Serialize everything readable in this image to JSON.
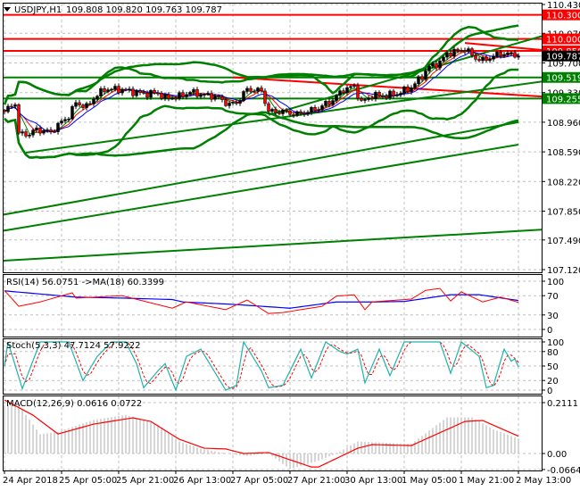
{
  "header": {
    "symbol": "USDJPY,H1",
    "ohlc": "109.808 109.820 109.763 109.787"
  },
  "indicators": {
    "rsi_label": "RSI(14) 56.0751  ->MA(18) 60.3399",
    "stoch_label": "Stoch(5,3,3) 47.7124 57.9222",
    "macd_label": "MACD(12,26,9) 0.0616 0.0722"
  },
  "colors": {
    "up": "#000000",
    "down": "#ff0000",
    "support": "#008000",
    "resistance": "#ff0000",
    "rsi": "#ff0000",
    "rsi_ma": "#0000ff",
    "stoch_main": "#20b2aa",
    "stoch_signal": "#ff0000",
    "macd_hist": "#c0c0c0",
    "macd_signal": "#ff0000",
    "current": "#000000"
  },
  "chart_data": [
    {
      "type": "candlestick",
      "title": "USDJPY,H1",
      "ylim": [
        107.12,
        110.43
      ],
      "y_ticks": [
        "110.430",
        "110.070",
        "109.700",
        "109.330",
        "108.960",
        "108.590",
        "108.220",
        "107.850",
        "107.490",
        "107.120"
      ],
      "x_ticks": [
        "24 Apr 2018",
        "25 Apr 05:00",
        "25 Apr 21:00",
        "26 Apr 13:00",
        "27 Apr 05:00",
        "27 Apr 21:00",
        "30 Apr 13:00",
        "1 May 05:00",
        "1 May 21:00",
        "2 May 13:00"
      ],
      "bars": 145,
      "close_keypoints": [
        [
          0,
          109.092
        ],
        [
          3,
          109.204
        ],
        [
          4,
          108.813
        ],
        [
          7,
          108.813
        ],
        [
          9,
          108.869
        ],
        [
          13,
          108.836
        ],
        [
          15,
          108.925
        ],
        [
          18,
          109.036
        ],
        [
          20,
          109.204
        ],
        [
          23,
          109.148
        ],
        [
          25,
          109.259
        ],
        [
          28,
          109.371
        ],
        [
          32,
          109.371
        ],
        [
          35,
          109.349
        ],
        [
          39,
          109.315
        ],
        [
          43,
          109.326
        ],
        [
          45,
          109.259
        ],
        [
          49,
          109.282
        ],
        [
          52,
          109.337
        ],
        [
          55,
          109.304
        ],
        [
          59,
          109.282
        ],
        [
          63,
          109.181
        ],
        [
          65,
          109.204
        ],
        [
          68,
          109.371
        ],
        [
          72,
          109.349
        ],
        [
          74,
          109.092
        ],
        [
          78,
          109.092
        ],
        [
          82,
          109.059
        ],
        [
          85,
          109.092
        ],
        [
          88,
          109.137
        ],
        [
          92,
          109.237
        ],
        [
          95,
          109.371
        ],
        [
          98,
          109.404
        ],
        [
          100,
          109.204
        ],
        [
          103,
          109.293
        ],
        [
          107,
          109.293
        ],
        [
          110,
          109.315
        ],
        [
          114,
          109.393
        ],
        [
          117,
          109.538
        ],
        [
          119,
          109.65
        ],
        [
          122,
          109.705
        ],
        [
          124,
          109.817
        ],
        [
          127,
          109.85
        ],
        [
          129,
          109.873
        ],
        [
          132,
          109.761
        ],
        [
          134,
          109.728
        ],
        [
          137,
          109.783
        ],
        [
          139,
          109.817
        ],
        [
          143,
          109.806
        ],
        [
          144,
          109.787
        ]
      ],
      "levels": [
        {
          "price": 110.3,
          "label": "110.300",
          "color": "#ff0000"
        },
        {
          "price": 110.0,
          "label": "110.000",
          "color": "#ff0000"
        },
        {
          "price": 109.85,
          "label": "109.850",
          "color": "#ff0000"
        },
        {
          "price": 109.787,
          "label": "109.787",
          "color": "#000000"
        },
        {
          "price": 109.519,
          "label": "109.519",
          "color": "#008000"
        },
        {
          "price": 109.255,
          "label": "109.255",
          "color": "#008000"
        }
      ],
      "trendlines": [
        {
          "from": [
            64,
            109.52
          ],
          "to": [
            151,
            109.28
          ],
          "color": "#ff0000"
        },
        {
          "from": [
            129,
            109.95
          ],
          "to": [
            151,
            109.86
          ],
          "color": "#ff0000"
        },
        {
          "from": [
            6,
            108.58
          ],
          "to": [
            151,
            109.47
          ],
          "color": "#008000"
        },
        {
          "from": [
            -1,
            107.8
          ],
          "to": [
            144,
            108.96
          ],
          "color": "#008000"
        },
        {
          "from": [
            -1,
            107.6
          ],
          "to": [
            144,
            108.68
          ],
          "color": "#008000"
        },
        {
          "from": [
            -1,
            107.23
          ],
          "to": [
            151,
            107.62
          ],
          "color": "#008000"
        },
        {
          "from": [
            74,
            109.05
          ],
          "to": [
            151,
            110.04
          ],
          "color": "#008000"
        }
      ]
    },
    {
      "type": "line",
      "title": "RSI(14)",
      "ylim": [
        0,
        100
      ],
      "y_ticks": [
        "100",
        "70",
        "30",
        "0"
      ],
      "series": [
        {
          "name": "RSI",
          "keypoints": [
            [
              0,
              81
            ],
            [
              4,
              48
            ],
            [
              10,
              57
            ],
            [
              19,
              76
            ],
            [
              20,
              65
            ],
            [
              33,
              70
            ],
            [
              47,
              44
            ],
            [
              51,
              57
            ],
            [
              62,
              41
            ],
            [
              68,
              61
            ],
            [
              74,
              33
            ],
            [
              78,
              35
            ],
            [
              89,
              48
            ],
            [
              93,
              69
            ],
            [
              98,
              72
            ],
            [
              101,
              41
            ],
            [
              103,
              57
            ],
            [
              114,
              63
            ],
            [
              118,
              81
            ],
            [
              122,
              85
            ],
            [
              125,
              59
            ],
            [
              128,
              78
            ],
            [
              134,
              57
            ],
            [
              139,
              67
            ],
            [
              144,
              56
            ]
          ]
        },
        {
          "name": "MA(18)",
          "keypoints": [
            [
              0,
              80
            ],
            [
              20,
              67
            ],
            [
              33,
              65
            ],
            [
              47,
              62
            ],
            [
              50,
              57
            ],
            [
              64,
              52
            ],
            [
              80,
              44
            ],
            [
              93,
              57
            ],
            [
              104,
              57
            ],
            [
              112,
              58
            ],
            [
              125,
              72
            ],
            [
              133,
              72
            ],
            [
              144,
              60
            ]
          ]
        }
      ]
    },
    {
      "type": "line",
      "title": "Stoch(5,3,3)",
      "ylim": [
        0,
        100
      ],
      "y_ticks": [
        "100",
        "80",
        "50",
        "20",
        "0"
      ],
      "series": [
        {
          "name": "Main",
          "keypoints": [
            [
              0,
              50
            ],
            [
              1,
              100
            ],
            [
              5,
              3
            ],
            [
              10,
              100
            ],
            [
              15,
              100
            ],
            [
              18,
              100
            ],
            [
              22,
              20
            ],
            [
              26,
              70
            ],
            [
              30,
              100
            ],
            [
              34,
              100
            ],
            [
              37,
              55
            ],
            [
              39,
              5
            ],
            [
              43,
              40
            ],
            [
              45,
              55
            ],
            [
              48,
              0
            ],
            [
              51,
              70
            ],
            [
              55,
              85
            ],
            [
              62,
              0
            ],
            [
              65,
              10
            ],
            [
              67,
              100
            ],
            [
              72,
              40
            ],
            [
              74,
              5
            ],
            [
              78,
              10
            ],
            [
              83,
              85
            ],
            [
              86,
              25
            ],
            [
              90,
              100
            ],
            [
              94,
              80
            ],
            [
              96,
              75
            ],
            [
              99,
              85
            ],
            [
              101,
              15
            ],
            [
              105,
              85
            ],
            [
              108,
              30
            ],
            [
              112,
              100
            ],
            [
              122,
              100
            ],
            [
              125,
              35
            ],
            [
              128,
              100
            ],
            [
              133,
              70
            ],
            [
              135,
              5
            ],
            [
              137,
              10
            ],
            [
              140,
              85
            ],
            [
              142,
              60
            ],
            [
              143,
              65
            ],
            [
              144,
              48
            ]
          ]
        }
      ]
    },
    {
      "type": "bar",
      "title": "MACD(12,26,9)",
      "ylim": [
        -0.0664,
        0.2111
      ],
      "y_ticks": [
        "0.2111",
        "0.00",
        "-0.0664"
      ],
      "series": [
        {
          "name": "MACD",
          "keypoints": [
            [
              0,
              0.2
            ],
            [
              4,
              0.2
            ],
            [
              10,
              0.08
            ],
            [
              15,
              0.09
            ],
            [
              25,
              0.14
            ],
            [
              34,
              0.16
            ],
            [
              43,
              0.12
            ],
            [
              49,
              0.05
            ],
            [
              55,
              0.02
            ],
            [
              62,
              0.0
            ],
            [
              68,
              -0.01
            ],
            [
              74,
              0.0
            ],
            [
              80,
              -0.065
            ],
            [
              88,
              -0.03
            ],
            [
              93,
              0.0
            ],
            [
              99,
              0.05
            ],
            [
              114,
              0.04
            ],
            [
              124,
              0.15
            ],
            [
              131,
              0.15
            ],
            [
              137,
              0.1
            ],
            [
              144,
              0.062
            ]
          ]
        },
        {
          "name": "Signal",
          "keypoints": [
            [
              0,
              0.222
            ],
            [
              8,
              0.159
            ],
            [
              15,
              0.081
            ],
            [
              25,
              0.122
            ],
            [
              36,
              0.148
            ],
            [
              41,
              0.133
            ],
            [
              49,
              0.059
            ],
            [
              56,
              0.022
            ],
            [
              62,
              0.019
            ],
            [
              67,
              0.0
            ],
            [
              74,
              0.004
            ],
            [
              86,
              -0.056
            ],
            [
              88,
              -0.056
            ],
            [
              99,
              0.022
            ],
            [
              103,
              0.037
            ],
            [
              114,
              0.033
            ],
            [
              129,
              0.133
            ],
            [
              134,
              0.137
            ],
            [
              144,
              0.072
            ]
          ]
        }
      ]
    }
  ]
}
